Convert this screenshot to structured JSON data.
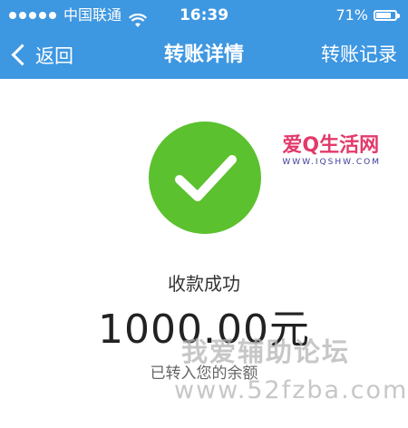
{
  "statusbar": {
    "carrier": "中国联通",
    "time": "16:39",
    "battery": "71%"
  },
  "navbar": {
    "back_label": "返回",
    "title": "转账详情",
    "right_label": "转账记录"
  },
  "result": {
    "status": "收款成功",
    "amount": "1000.00元",
    "note": "已转入您的余额"
  },
  "watermarks": {
    "logo": "爱Q生活网",
    "logo_url": "WWW.IQSHW.COM",
    "line1": "我爱辅助论坛",
    "line2": "www.52fzba.com"
  },
  "colors": {
    "header_bg": "#3e97e1",
    "success_green": "#5bc12e"
  },
  "icons": {
    "signal": "signal-dots-icon",
    "wifi": "wifi-icon",
    "battery": "battery-icon",
    "back": "chevron-left-icon",
    "success": "checkmark-circle-icon"
  }
}
